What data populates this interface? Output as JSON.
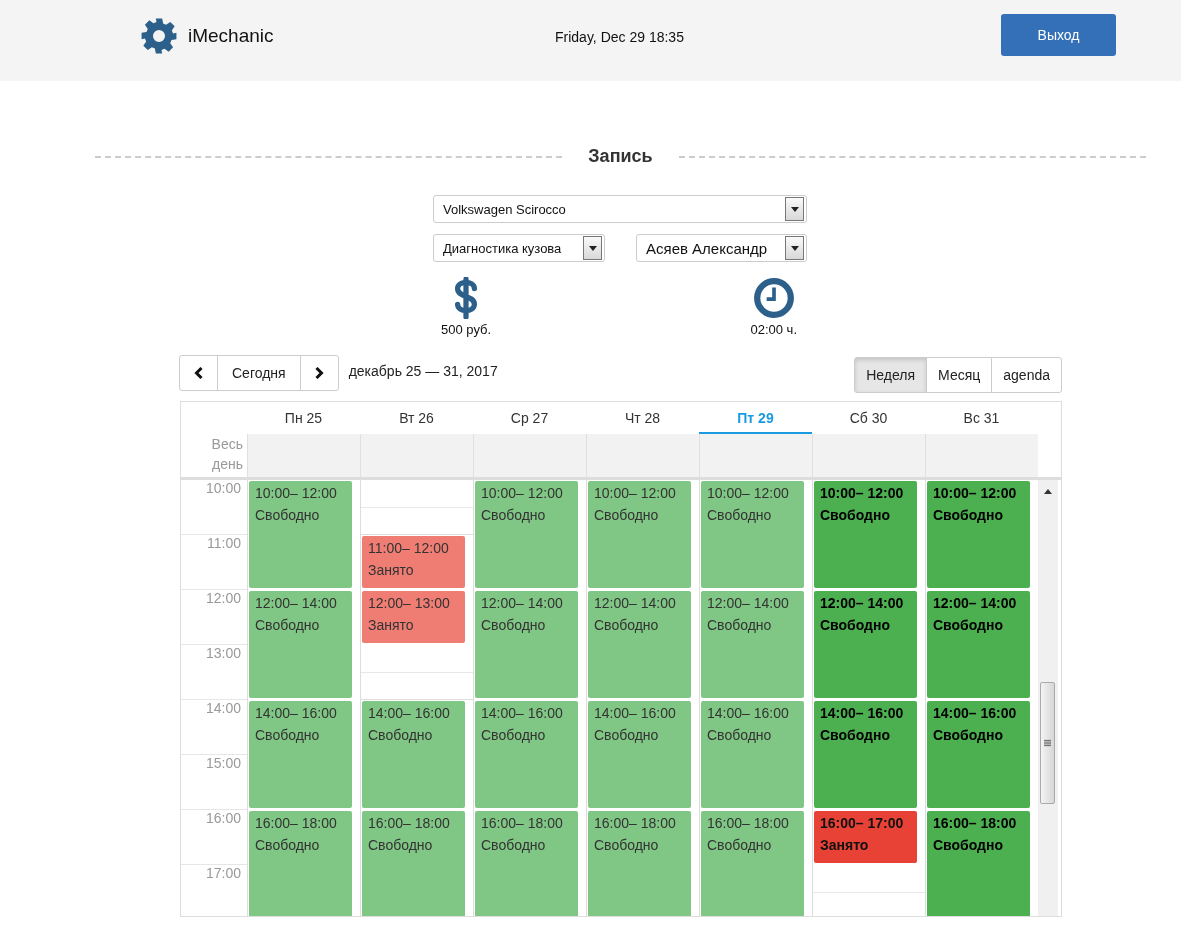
{
  "header": {
    "app_name": "iMechanic",
    "datetime": "Friday, Dec 29 18:35",
    "logout": "Выход"
  },
  "title": "Запись",
  "car_select": {
    "value": "Volkswagen Scirocco"
  },
  "service_select": {
    "value": "Диагностика кузова"
  },
  "mechanic_select": {
    "value": "Асяев Александр"
  },
  "price": "500 руб.",
  "duration": "02:00 ч.",
  "toolbar": {
    "today": "Сегодня",
    "range": "декабрь 25 — 31, 2017",
    "views": [
      {
        "label": "Неделя",
        "selected": true
      },
      {
        "label": "Месяц",
        "selected": false
      },
      {
        "label": "agenda",
        "selected": false
      }
    ]
  },
  "all_day_label": "Весь день",
  "hours": [
    "10:00",
    "11:00",
    "12:00",
    "13:00",
    "14:00",
    "15:00",
    "16:00",
    "17:00"
  ],
  "days": [
    {
      "label": "Пн 25",
      "today": false,
      "events": [
        {
          "time": "10:00– 12:00",
          "status": "Свободно",
          "kind": "free",
          "past": true
        },
        {
          "time": "12:00– 14:00",
          "status": "Свободно",
          "kind": "free",
          "past": true
        },
        {
          "time": "14:00– 16:00",
          "status": "Свободно",
          "kind": "free",
          "past": true
        },
        {
          "time": "16:00– 18:00",
          "status": "Свободно",
          "kind": "free",
          "past": true
        }
      ]
    },
    {
      "label": "Вт 26",
      "today": false,
      "events": [
        {
          "time": "11:00– 12:00",
          "status": "Занято",
          "kind": "busy",
          "past": true
        },
        {
          "time": "12:00– 13:00",
          "status": "Занято",
          "kind": "busy",
          "past": true
        },
        {
          "time": "14:00– 16:00",
          "status": "Свободно",
          "kind": "free",
          "past": true
        },
        {
          "time": "16:00– 18:00",
          "status": "Свободно",
          "kind": "free",
          "past": true
        }
      ]
    },
    {
      "label": "Ср 27",
      "today": false,
      "events": [
        {
          "time": "10:00– 12:00",
          "status": "Свободно",
          "kind": "free",
          "past": true
        },
        {
          "time": "12:00– 14:00",
          "status": "Свободно",
          "kind": "free",
          "past": true
        },
        {
          "time": "14:00– 16:00",
          "status": "Свободно",
          "kind": "free",
          "past": true
        },
        {
          "time": "16:00– 18:00",
          "status": "Свободно",
          "kind": "free",
          "past": true
        }
      ]
    },
    {
      "label": "Чт 28",
      "today": false,
      "events": [
        {
          "time": "10:00– 12:00",
          "status": "Свободно",
          "kind": "free",
          "past": true
        },
        {
          "time": "12:00– 14:00",
          "status": "Свободно",
          "kind": "free",
          "past": true
        },
        {
          "time": "14:00– 16:00",
          "status": "Свободно",
          "kind": "free",
          "past": true
        },
        {
          "time": "16:00– 18:00",
          "status": "Свободно",
          "kind": "free",
          "past": true
        }
      ]
    },
    {
      "label": "Пт 29",
      "today": true,
      "events": [
        {
          "time": "10:00– 12:00",
          "status": "Свободно",
          "kind": "free",
          "past": true
        },
        {
          "time": "12:00– 14:00",
          "status": "Свободно",
          "kind": "free",
          "past": true
        },
        {
          "time": "14:00– 16:00",
          "status": "Свободно",
          "kind": "free",
          "past": true
        },
        {
          "time": "16:00– 18:00",
          "status": "Свободно",
          "kind": "free",
          "past": true
        }
      ]
    },
    {
      "label": "Сб 30",
      "today": false,
      "events": [
        {
          "time": "10:00– 12:00",
          "status": "Свободно",
          "kind": "free",
          "past": false
        },
        {
          "time": "12:00– 14:00",
          "status": "Свободно",
          "kind": "free",
          "past": false
        },
        {
          "time": "14:00– 16:00",
          "status": "Свободно",
          "kind": "free",
          "past": false
        },
        {
          "time": "16:00– 17:00",
          "status": "Занято",
          "kind": "busy",
          "past": false
        }
      ]
    },
    {
      "label": "Вс 31",
      "today": false,
      "events": [
        {
          "time": "10:00– 12:00",
          "status": "Свободно",
          "kind": "free",
          "past": false
        },
        {
          "time": "12:00– 14:00",
          "status": "Свободно",
          "kind": "free",
          "past": false
        },
        {
          "time": "14:00– 16:00",
          "status": "Свободно",
          "kind": "free",
          "past": false
        },
        {
          "time": "16:00– 18:00",
          "status": "Свободно",
          "kind": "free",
          "past": false
        }
      ]
    }
  ]
}
